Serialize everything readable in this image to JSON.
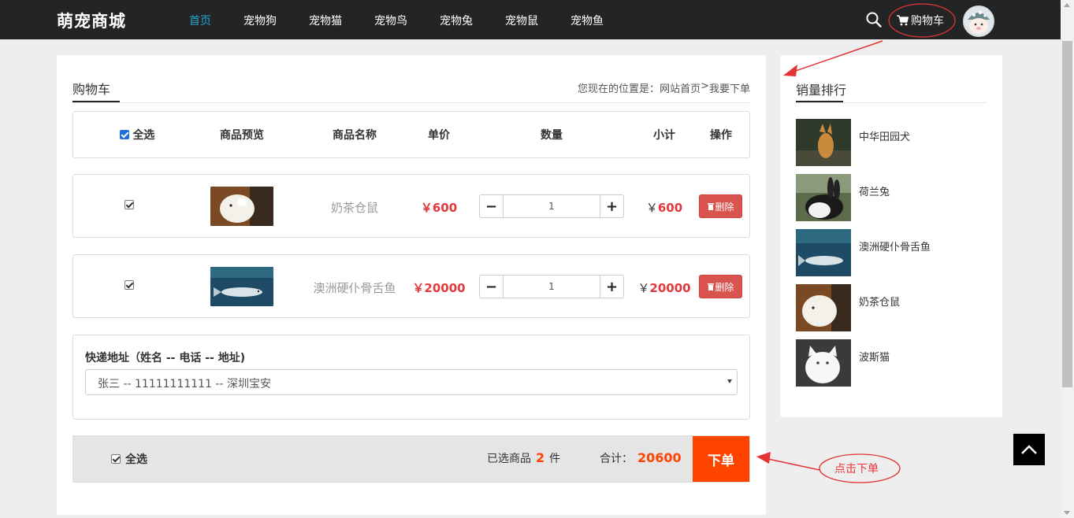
{
  "header": {
    "logo": "萌宠商城",
    "nav": [
      "首页",
      "宠物狗",
      "宠物猫",
      "宠物鸟",
      "宠物兔",
      "宠物鼠",
      "宠物鱼"
    ],
    "active_nav": "首页",
    "cart_label": "购物车",
    "accent_color": "#2aa4c9"
  },
  "main": {
    "title": "购物车",
    "breadcrumb": {
      "prefix": "您现在的位置是：",
      "home": "网站首页",
      "sep": ">",
      "current": "我要下单"
    },
    "table_header": {
      "select_all": "全选",
      "preview": "商品预览",
      "name": "商品名称",
      "price": "单价",
      "qty": "数量",
      "subtotal": "小计",
      "action": "操作"
    },
    "items": [
      {
        "checked": true,
        "thumb_icon": "hamster-image",
        "name": "奶茶仓鼠",
        "price": "￥600",
        "qty": "1",
        "subtotal_sign": "￥",
        "subtotal": "600",
        "delete_label": "删除"
      },
      {
        "checked": true,
        "thumb_icon": "arowana-fish-image",
        "name": "澳洲硬仆骨舌鱼",
        "price": "￥20000",
        "qty": "1",
        "subtotal_sign": "￥",
        "subtotal": "20000",
        "delete_label": "删除"
      }
    ],
    "address": {
      "label": "快递地址（姓名 -- 电话 -- 地址)",
      "selected": "张三 -- 11111111111 -- 深圳宝安"
    },
    "footer": {
      "select_all": "全选",
      "selected_prefix": "已选商品",
      "selected_count": "2",
      "selected_unit": "件",
      "total_label": "合计：",
      "total_value": "20600",
      "order_button": "下单"
    }
  },
  "sidebar": {
    "title": "销量排行",
    "items": [
      {
        "name": "中华田园犬",
        "icon": "dog-image"
      },
      {
        "name": "荷兰兔",
        "icon": "rabbit-image"
      },
      {
        "name": "澳洲硬仆骨舌鱼",
        "icon": "arowana-fish-image"
      },
      {
        "name": "奶茶仓鼠",
        "icon": "hamster-image"
      },
      {
        "name": "波斯猫",
        "icon": "persian-cat-image"
      }
    ]
  },
  "annotation": {
    "callout_text": "点击下单",
    "color": "#e33333"
  },
  "colors": {
    "price_red": "#e4393c",
    "order_orange": "#ff4400",
    "delete_red": "#d9534f",
    "topbar": "#222426"
  }
}
